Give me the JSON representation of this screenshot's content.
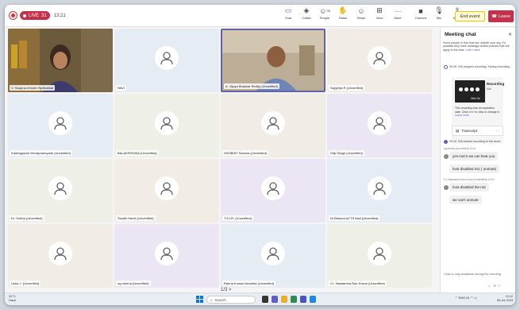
{
  "topbar": {
    "rec_label": "LIVE",
    "rec_time": "31",
    "clock": "13:21",
    "tools": [
      {
        "label": "Chat",
        "icon": "chat-icon"
      },
      {
        "label": "Collab",
        "icon": "collab-icon"
      },
      {
        "label": "People",
        "icon": "people-icon",
        "count": "38"
      },
      {
        "label": "Raise",
        "icon": "hand-icon"
      },
      {
        "label": "React",
        "icon": "react-icon"
      },
      {
        "label": "View",
        "icon": "view-icon"
      },
      {
        "label": "More",
        "icon": "more-icon"
      },
      {
        "label": "Camera",
        "icon": "camera-icon"
      },
      {
        "label": "Mic",
        "icon": "mic-icon"
      },
      {
        "label": "Share",
        "icon": "share-icon"
      }
    ],
    "end_event": "End event",
    "leave": "Leave"
  },
  "tiles": [
    {
      "name": "V. Swapna remote Hyderabad",
      "type": "video"
    },
    {
      "name": "NAVI"
    },
    {
      "name": "A. Vijaya Bhaskar Reddy (Unverified)",
      "type": "video",
      "selected": true
    },
    {
      "name": "Saypriya R (Unverified)"
    },
    {
      "name": "Kaleragonda Veerapraneyadu (Unverified)"
    },
    {
      "name": "BALAKRISHNA (Unverified)"
    },
    {
      "name": "SHOBHIT Saxena (Unverified)"
    },
    {
      "name": "Dilip Singh (Unverified)"
    },
    {
      "name": "Dr. Sudha (Unverified)"
    },
    {
      "name": "Swathi Harsh (Unverified)"
    },
    {
      "name": "T.S.I.R. (Unverified)"
    },
    {
      "name": "Dr.Bhavna ACTS Mali (Unverified)"
    },
    {
      "name": "Usha J. (Unverified)"
    },
    {
      "name": "ng meena (Unverified)"
    },
    {
      "name": "Rahna Kumari Anantha (Unverified)"
    },
    {
      "name": "V.I. Narasimha Rao Kosuri (Unverified)"
    }
  ],
  "pager": "1/3 >",
  "chat": {
    "title": "Meeting chat",
    "notice": "Some people in this chat are outside your org. It's possible they have message related policies that will apply to the chat.",
    "learn_more": "Learn more",
    "event1_time": "09:45",
    "event1_text": "N/A stopped recording. Saving recording...",
    "recording_title": "Recording",
    "recording_sub": "N/A",
    "recording_duration": "26m 3s",
    "expiration_text": "This recording has an expiration date. Click",
    "expiration_here": "here",
    "expiration_tail": "to view or change it.",
    "expiration_learn": "Learn more",
    "transcript": "Transcript",
    "event2_time": "09:10",
    "event2_text": "N/A started recording to the cloud",
    "msg1_meta": "ng meena (Unverified)  10:01",
    "msg1": "yes ma'm we can hear you",
    "msg2": "host disabled mic ( unmute)",
    "msg3_meta": "V.I. Narasimha Rao Kosuri (Unverified)  10:02",
    "msg3": "host disabled the mic",
    "msg4": "we can't unmute",
    "footer": "Chat is only available during the meeting"
  },
  "taskbar": {
    "weather_temp": "31°C",
    "weather_desc": "Haze",
    "search": "Search",
    "lang": "ENG",
    "region": "IN",
    "time": "10:12",
    "date": "06-Jul-2023"
  },
  "colors": {
    "accent": "#5b5fc7",
    "leave": "#c4314b",
    "live": "#c4314b"
  }
}
